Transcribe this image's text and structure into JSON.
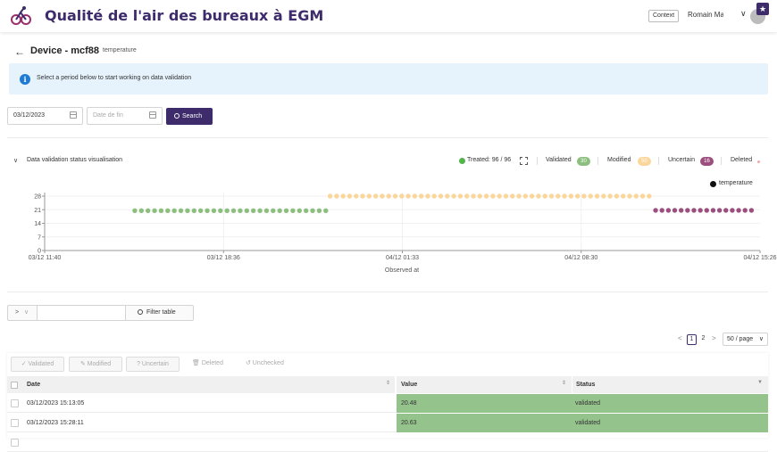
{
  "header": {
    "app_title": "Qualité de l'air des bureaux à EGM",
    "context_label": "Context",
    "user_name": "Romain Ma",
    "star_glyph": "★"
  },
  "page": {
    "back_glyph": "←",
    "title": "Device - mcf88",
    "subtitle": "temperature"
  },
  "alert": {
    "icon_glyph": "i",
    "text": "Select a period below to start working on data validation"
  },
  "search": {
    "date_from": "03/12/2023",
    "date_to_placeholder": "Date de fin",
    "search_label": "Search"
  },
  "visualisation": {
    "chevron": "⌄",
    "title": "Data validation status visualisation",
    "treated_label": "Treated: 96 / 96",
    "validated_label": "Validated",
    "validated_count": "30",
    "modified_label": "Modified",
    "modified_count": "50",
    "uncertain_label": "Uncertain",
    "uncertain_count": "16",
    "deleted_label": "Deleted",
    "colors": {
      "validated": "#8cbf7e",
      "modified": "#fbd69b",
      "uncertain": "#9c4f7f",
      "treated": "#52b44b",
      "accent": "#3d2b6b"
    }
  },
  "chart_data": {
    "type": "scatter",
    "xlabel": "Observed at",
    "ylabel": "",
    "x_tick_labels": [
      "03/12 11:40",
      "03/12 18:36",
      "04/12 01:33",
      "04/12 08:30",
      "04/12 15:26"
    ],
    "y_ticks": [
      0,
      7,
      14,
      21,
      28
    ],
    "ylim": [
      0,
      28
    ],
    "legend": [
      "temperature"
    ],
    "legend_position": "top-right",
    "grid": true,
    "series": [
      {
        "name": "temperature",
        "status": "validated",
        "color": "#8cbf7e",
        "x_start": 0.126,
        "x_end": 0.393,
        "count": 30,
        "value": 20.5
      },
      {
        "name": "temperature",
        "status": "modified",
        "color": "#fbd69b",
        "x_start": 0.399,
        "x_end": 0.845,
        "count": 50,
        "value": 28
      },
      {
        "name": "temperature",
        "status": "uncertain",
        "color": "#9c4f7f",
        "x_start": 0.854,
        "x_end": 0.988,
        "count": 16,
        "value": 20.7
      }
    ]
  },
  "filter": {
    "select_label": ">",
    "select_chevron": "⌄",
    "button_label": "Filter table"
  },
  "pagination": {
    "prev": "<",
    "page1": "1",
    "page2": "2",
    "next": ">",
    "page_size": "50 / page",
    "size_chevron": "⌄"
  },
  "actions": {
    "validated": "✓  Validated",
    "modified": "✎  Modified",
    "uncertain": "?  Uncertain",
    "deleted": "🗑  Deleted",
    "unchecked": "↺  Unchecked"
  },
  "table": {
    "columns": [
      "Date",
      "Value",
      "Status"
    ],
    "sort_glyph": "⇕",
    "filter_glyph": "▼",
    "rows": [
      {
        "date": "03/12/2023 15:13:05",
        "value": "20.48",
        "status": "validated"
      },
      {
        "date": "03/12/2023 15:28:11",
        "value": "20.63",
        "status": "validated"
      },
      {
        "date": "",
        "value": "",
        "status": ""
      }
    ]
  }
}
